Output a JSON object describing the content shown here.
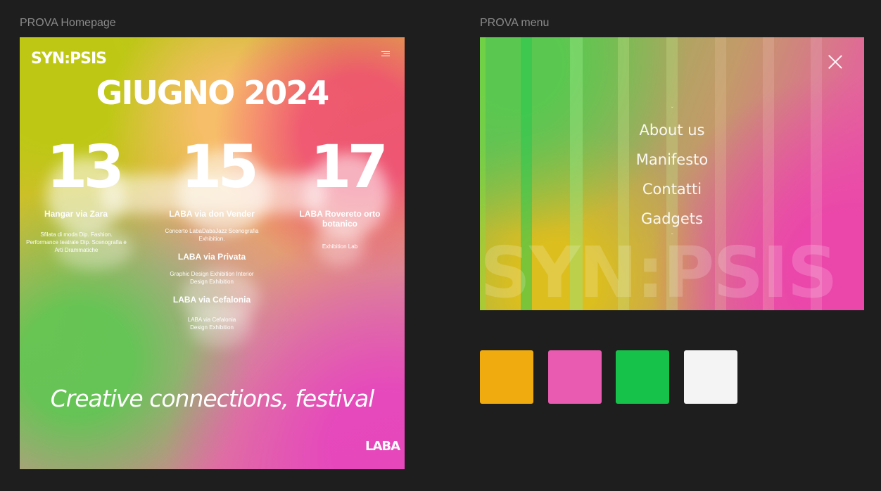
{
  "frames": {
    "homepage_label": "PROVA Homepage",
    "menu_label": "PROVA menu"
  },
  "homepage": {
    "logo": "SYN:PSIS",
    "title": "GIUGNO 2024",
    "events": [
      {
        "day": "13",
        "title": "Hangar via Zara",
        "description": "Sfilata di moda Dip. Fashion. Performance teatrale Dip. Scenografia e Arti Drammatiche"
      },
      {
        "day": "15",
        "title": "LABA via don Vender",
        "description": "Concerto LabaDabaJazz Scenografia Exhibition.",
        "sub_events": [
          {
            "title": "LABA via Privata",
            "description": "Graphic Design Exhibition Interior Design Exhibition"
          },
          {
            "title": "LABA via Cefalonia",
            "description": "LABA via Cefalonia Design Exhibition"
          }
        ]
      },
      {
        "day": "17",
        "title": "LABA Rovereto orto botanico",
        "description": "Exhibition Lab"
      }
    ],
    "tagline": "Creative connections, festival",
    "footer_logo": "LABA",
    "menu_icon": "hamburger-icon"
  },
  "menu": {
    "close_icon": "close-icon",
    "items": [
      "About us",
      "Manifesto",
      "Contatti",
      "Gadgets"
    ],
    "watermark": "SYN:PSIS"
  },
  "palette": {
    "colors": [
      "#f0ac0e",
      "#e85bb0",
      "#17c24a",
      "#f4f4f4"
    ]
  }
}
